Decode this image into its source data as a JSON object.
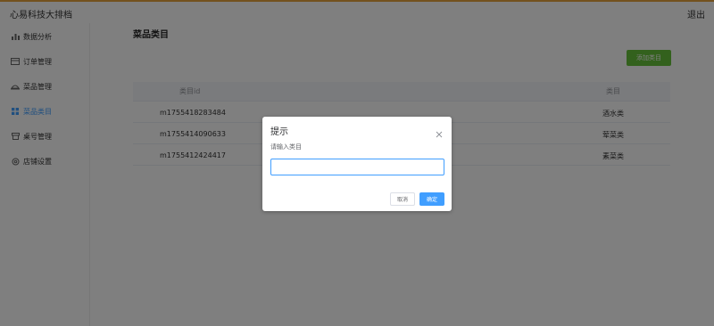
{
  "header": {
    "app_title": "心易科技大排档",
    "logout_label": "退出"
  },
  "sidebar": {
    "items": [
      {
        "label": "数据分析",
        "icon": "bar-chart-icon"
      },
      {
        "label": "订单管理",
        "icon": "order-card-icon"
      },
      {
        "label": "菜品管理",
        "icon": "dish-icon"
      },
      {
        "label": "菜品类目",
        "icon": "grid-icon",
        "active": true
      },
      {
        "label": "桌号管理",
        "icon": "table-icon"
      },
      {
        "label": "店铺设置",
        "icon": "gear-icon"
      }
    ]
  },
  "main": {
    "title": "菜品类目",
    "add_button_label": "添加类目",
    "table": {
      "headers": {
        "id": "类目id",
        "name": "类目"
      },
      "rows": [
        {
          "id": "m1755418283484",
          "name": "酒水类"
        },
        {
          "id": "m1755414090633",
          "name": "荤菜类"
        },
        {
          "id": "m1755412424417",
          "name": "素菜类"
        }
      ]
    }
  },
  "dialog": {
    "title": "提示",
    "message": "请输入类目",
    "input_value": "",
    "cancel_label": "取消",
    "confirm_label": "确定"
  },
  "colors": {
    "primary": "#409eff",
    "success": "#67c23a",
    "top_accent": "#e6a23c"
  }
}
